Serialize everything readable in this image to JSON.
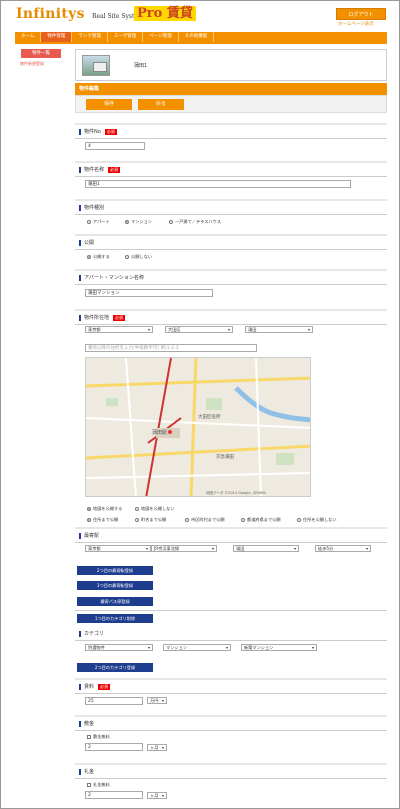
{
  "header": {
    "logo_main": "Infinitys",
    "logo_sub": "Real Site System",
    "logo_pro": "Pro 賃貸",
    "logout_label": "ログアウト",
    "top_link": "ホームページ表示"
  },
  "nav": {
    "items": [
      "ホーム",
      "物件管理",
      "ランク管理",
      "スーザ管理",
      "ページ管理",
      "その他機能"
    ],
    "active_index": 1
  },
  "sidebar": {
    "primary_button": "物件一覧",
    "link": "物件新規登録"
  },
  "property": {
    "name": "蒲田1"
  },
  "edit_band": "物件編集",
  "actions": {
    "save_label": "保存",
    "back_label": "戻る"
  },
  "required_badge": "必須",
  "fields": {
    "property_no": {
      "label": "物件No",
      "value": "4"
    },
    "property_name": {
      "label": "物件名称",
      "value": "蒲田1"
    },
    "property_type": {
      "label": "物件種別",
      "options": [
        "アパート",
        "マンション",
        "一戸建て／テラスハウス"
      ],
      "selected": 1
    },
    "publish": {
      "label": "公開",
      "options": [
        "公開する",
        "公開しない"
      ],
      "selected": 0
    },
    "building_name": {
      "label": "アパート・マンション名称",
      "value": "蒲田マンション"
    },
    "address": {
      "label": "物件所在地",
      "prefecture": "東京都",
      "city": "大田区",
      "town": "蒲田",
      "address_placeholder": "番地以降の住所を入力(半角数字可) 例)1-2-3",
      "map_options_row1": [
        "地図を公開する",
        "地図を公開しない"
      ],
      "map_options_row2": [
        "住所まで公開",
        "町名まで公開",
        "市区町村まで公開",
        "都道府県まで公開",
        "住所を公開しない"
      ]
    },
    "station": {
      "label": "最寄駅",
      "prefecture": "東京都",
      "line": "JR京浜東北線",
      "station": "蒲田",
      "walk": "徒歩5分"
    },
    "station_buttons": [
      "2つ目の最寄駅登録",
      "3つ目の最寄駅登録",
      "最寄バス停登録"
    ],
    "category_button": "1つ目のカテゴリ削除",
    "category": {
      "label": "カテゴリ",
      "cat1": "特選物件",
      "cat2": "マンション",
      "cat3": "新築マンション"
    },
    "category_add_button": "2つ目のカテゴリ登録",
    "rent": {
      "label": "賃料",
      "value": "25",
      "unit": "万円"
    },
    "deposit": {
      "label": "敷金",
      "checkbox": "敷金無料",
      "value": "2",
      "unit": "ヶ月"
    },
    "key_money": {
      "label": "礼金",
      "checkbox": "礼金無料",
      "value": "2",
      "unit": "ヶ月"
    }
  },
  "map": {
    "labels": [
      "蒲田駅",
      "大田区役所",
      "京急蒲田",
      "地図データ ©2014 Google, ZENRIN"
    ]
  }
}
